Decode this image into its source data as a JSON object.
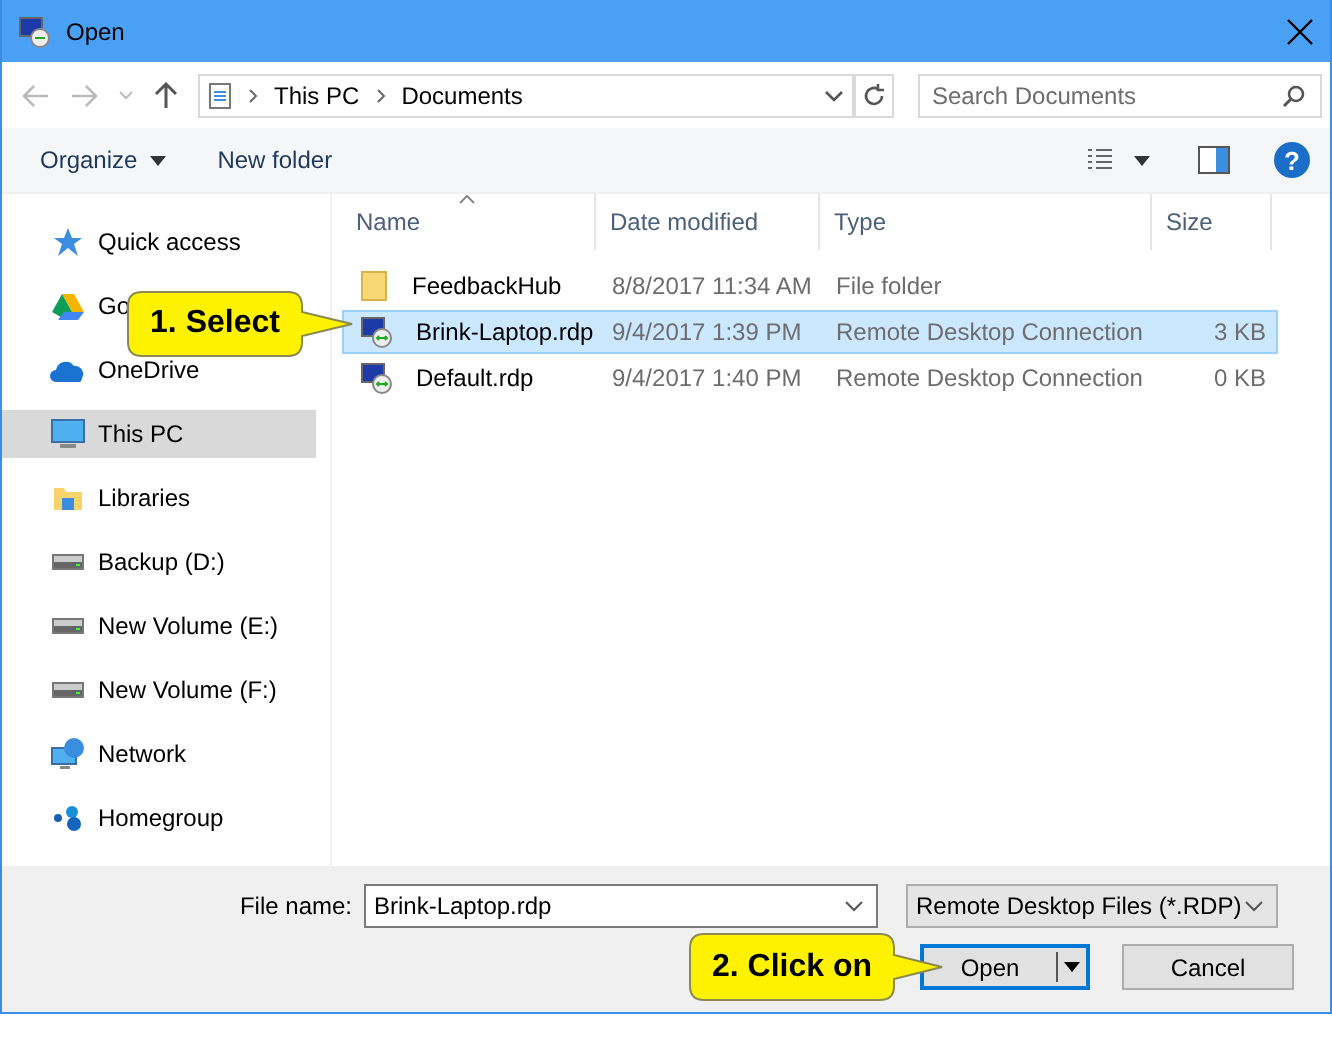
{
  "window": {
    "title": "Open"
  },
  "address_bar": {
    "path": [
      {
        "label": "This PC"
      },
      {
        "label": "Documents"
      }
    ]
  },
  "search": {
    "placeholder": "Search Documents"
  },
  "toolbar": {
    "buttons": [
      {
        "label": "Organize",
        "kind": "menu"
      },
      {
        "label": "New folder",
        "kind": "plain"
      }
    ],
    "help": "?"
  },
  "sidebar": {
    "items": [
      {
        "label": "Quick access",
        "selected": false
      },
      {
        "label": "Go",
        "selected": false
      },
      {
        "label": "OneDrive",
        "selected": false
      },
      {
        "label": "This PC",
        "selected": true
      },
      {
        "label": "Libraries",
        "selected": false
      },
      {
        "label": "Backup (D:)",
        "selected": false
      },
      {
        "label": "New Volume (E:)",
        "selected": false
      },
      {
        "label": "New Volume (F:)",
        "selected": false
      },
      {
        "label": "Network",
        "selected": false
      },
      {
        "label": "Homegroup",
        "selected": false
      }
    ]
  },
  "table": {
    "columns": [
      "Name",
      "Date modified",
      "Type",
      "Size"
    ],
    "rows": [
      {
        "name": "FeedbackHub",
        "date": "8/8/2017 11:34 AM",
        "type": "File folder",
        "kind": "folder",
        "selected": false
      },
      {
        "name": "Brink-Laptop.rdp",
        "date": "9/4/2017 1:39 PM",
        "type": "Remote Desktop Connection",
        "size": "3 KB",
        "kind": "file",
        "selected": true
      },
      {
        "name": "Default.rdp",
        "date": "9/4/2017 1:40 PM",
        "type": "Remote Desktop Connection",
        "size": "0 KB",
        "kind": "file",
        "selected": false
      }
    ]
  },
  "file_name": {
    "label": "File name:",
    "value": "Brink-Laptop.rdp"
  },
  "file_type": {
    "value": "Remote Desktop Files (*.RDP)"
  },
  "buttons": [
    {
      "label": "Open",
      "kind": "split"
    },
    {
      "label": "Cancel",
      "kind": "plain"
    }
  ],
  "callouts": [
    {
      "text": "1. Select"
    },
    {
      "text": "2. Click on"
    }
  ]
}
